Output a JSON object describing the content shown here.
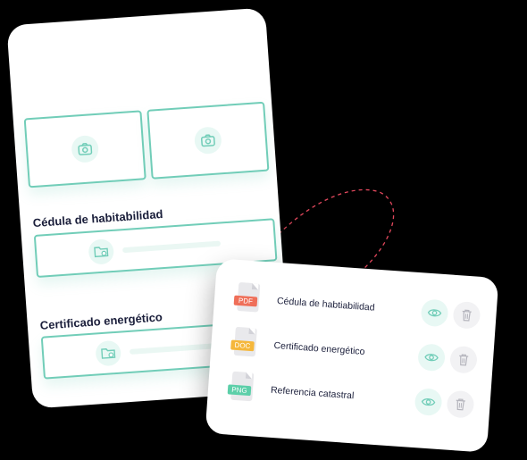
{
  "upload_form": {
    "sections": [
      {
        "label": "Cédula de habitabilidad",
        "progress": 0.0
      },
      {
        "label": "Certificado energético",
        "progress": 0.0
      }
    ]
  },
  "documents": {
    "items": [
      {
        "type": "PDF",
        "name": "Cédula de habtiabilidad",
        "tag_color": "#ef6f59"
      },
      {
        "type": "DOC",
        "name": "Certificado energético",
        "tag_color": "#f5b73b"
      },
      {
        "type": "PNG",
        "name": "Referencia catastral",
        "tag_color": "#5ccfa9"
      }
    ]
  },
  "colors": {
    "accent": "#71cdb8",
    "accent_light": "#e8f8f4",
    "text": "#1b1f3b",
    "link_dashes": "#e2485d"
  },
  "icons": {
    "photo_upload": "camera-icon",
    "file_upload": "folder-upload-icon",
    "view": "eye-icon",
    "delete": "trash-icon"
  }
}
